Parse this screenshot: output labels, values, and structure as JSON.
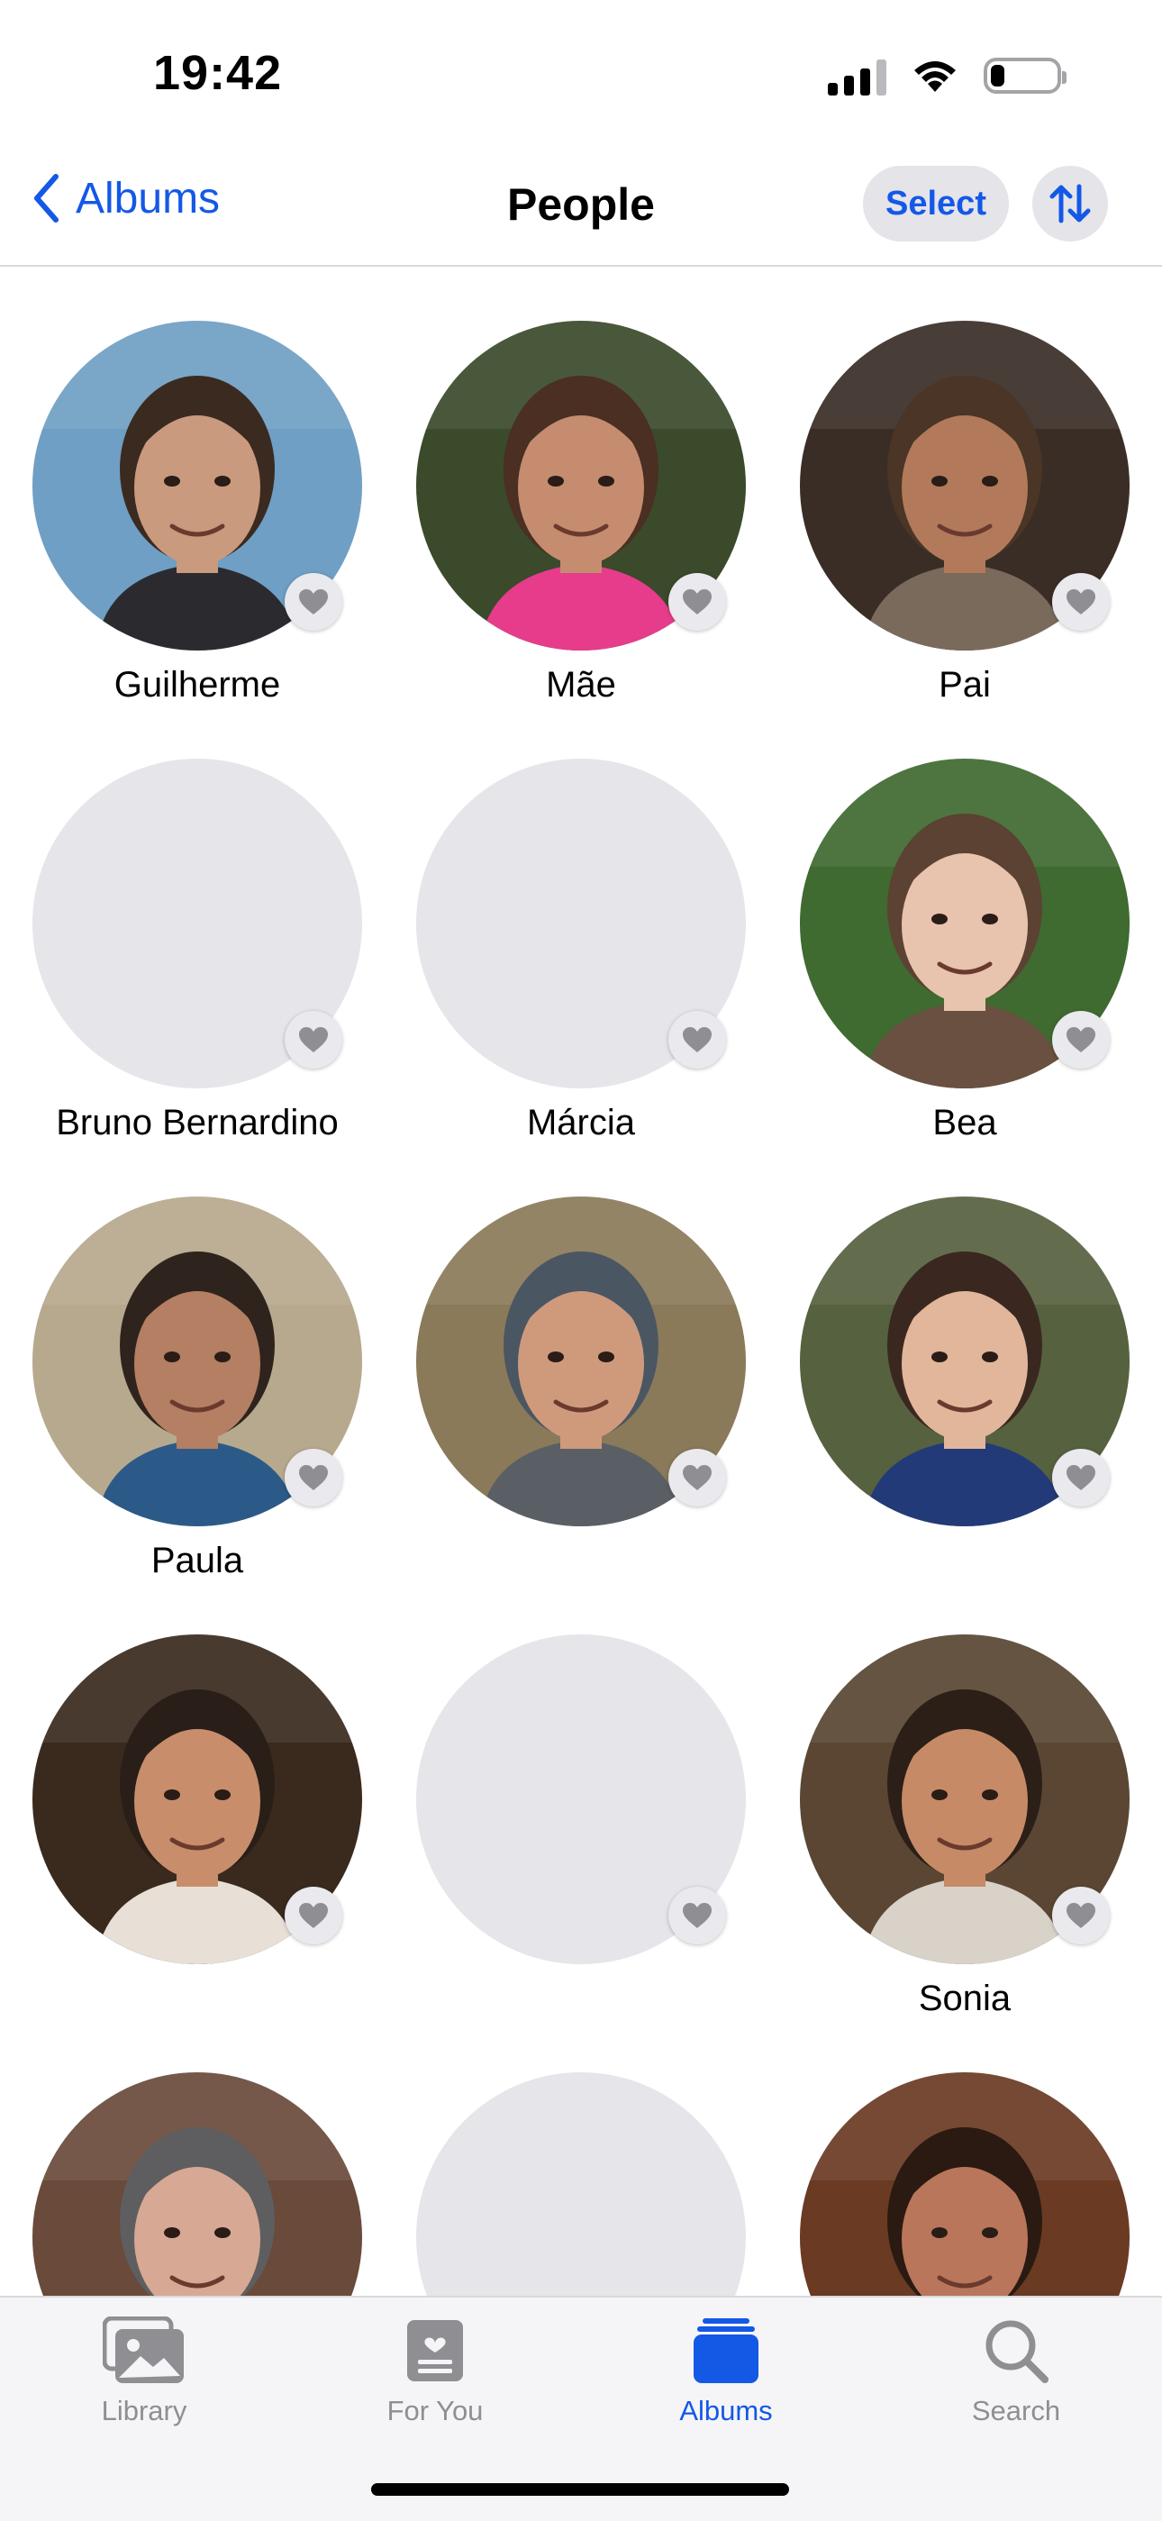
{
  "status_bar": {
    "time": "19:42"
  },
  "nav": {
    "back_label": "Albums",
    "title": "People",
    "select_label": "Select"
  },
  "people": [
    {
      "name": "Guilherme",
      "has_photo": true,
      "bg": "#6f9fc4",
      "skin": "#c99a7e",
      "hair": "#3b2a20",
      "shirt": "#2b2b2f"
    },
    {
      "name": "Mãe",
      "has_photo": true,
      "bg": "#3a4a2a",
      "skin": "#c58c70",
      "hair": "#4a2f22",
      "shirt": "#e63c8b"
    },
    {
      "name": "Pai",
      "has_photo": true,
      "bg": "#3a2d26",
      "skin": "#b27a5a",
      "hair": "#4a3526",
      "shirt": "#7a6a5c"
    },
    {
      "name": "Bruno Bernardino",
      "has_photo": false
    },
    {
      "name": "Márcia",
      "has_photo": false
    },
    {
      "name": "Bea",
      "has_photo": true,
      "bg": "#3f6a30",
      "skin": "#e8c3ad",
      "hair": "#5b4232",
      "shirt": "#6a5040"
    },
    {
      "name": "Paula",
      "has_photo": true,
      "bg": "#b7a98e",
      "skin": "#b47f62",
      "hair": "#2f231d",
      "shirt": "#2c5a88"
    },
    {
      "name": "",
      "has_photo": true,
      "bg": "#8a7a5a",
      "skin": "#cf9a7c",
      "hair": "#4a5662",
      "shirt": "#5a5f66"
    },
    {
      "name": "",
      "has_photo": true,
      "bg": "#56613f",
      "skin": "#e2b69b",
      "hair": "#3a2820",
      "shirt": "#233a78"
    },
    {
      "name": "",
      "has_photo": true,
      "bg": "#3a2a1e",
      "skin": "#c88e6b",
      "hair": "#2a1e18",
      "shirt": "#e8e0d6"
    },
    {
      "name": "",
      "has_photo": false
    },
    {
      "name": "Sonia",
      "has_photo": true,
      "bg": "#5a4632",
      "skin": "#c68a66",
      "hair": "#2b1f18",
      "shirt": "#d8d2c8"
    },
    {
      "name": "",
      "has_photo": true,
      "bg": "#6a4a3a",
      "skin": "#d7a894",
      "hair": "#5e5e60",
      "shirt": "#2a2a2c"
    },
    {
      "name": "",
      "has_photo": false
    },
    {
      "name": "",
      "has_photo": true,
      "bg": "#6a3a22",
      "skin": "#b9765a",
      "hair": "#2a1a12",
      "shirt": "#8a4a2a"
    }
  ],
  "tabs": [
    {
      "label": "Library",
      "icon": "photo-stack-icon",
      "active": false
    },
    {
      "label": "For You",
      "icon": "for-you-icon",
      "active": false
    },
    {
      "label": "Albums",
      "icon": "albums-icon",
      "active": true
    },
    {
      "label": "Search",
      "icon": "search-icon",
      "active": false
    }
  ],
  "colors": {
    "accent": "#1458e6",
    "placeholder": "#e5e5ea",
    "inactive": "#8e8e93"
  },
  "battery_level": 0.22
}
